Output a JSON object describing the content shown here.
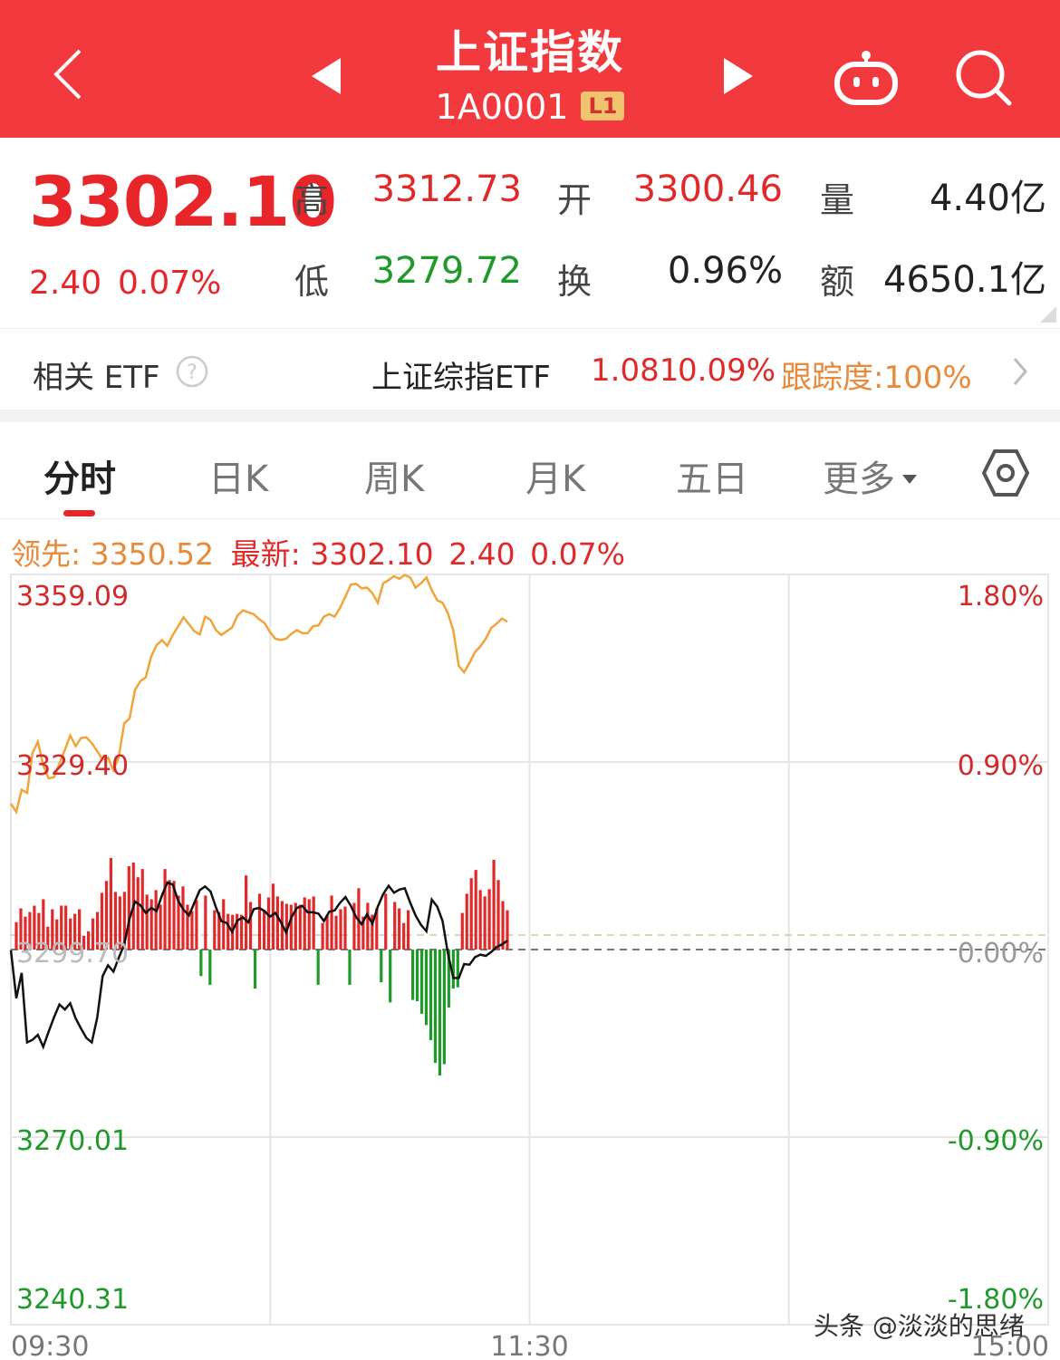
{
  "header": {
    "title": "上证指数",
    "code": "1A0001",
    "badge": "L1"
  },
  "quote": {
    "price": "3302.10",
    "change": "2.40",
    "change_pct": "0.07%",
    "high_label": "高",
    "high": "3312.73",
    "low_label": "低",
    "low": "3279.72",
    "open_label": "开",
    "open": "3300.46",
    "turnover_label": "换",
    "turnover": "0.96%",
    "volume_label": "量",
    "volume": "4.40亿",
    "amount_label": "额",
    "amount": "4650.1亿"
  },
  "etf": {
    "label": "相关 ETF",
    "name": "上证综指ETF",
    "price": "1.081",
    "pct": "0.09%",
    "tracking": "跟踪度:100%"
  },
  "tabs": [
    "分时",
    "日K",
    "周K",
    "月K",
    "五日",
    "更多"
  ],
  "legend": {
    "leader_label": "领先:",
    "leader_value": "3350.52",
    "latest_label": "最新:",
    "latest_value": "3302.10",
    "latest_change": "2.40",
    "latest_pct": "0.07%"
  },
  "watermark": "头条 @淡淡的思绪",
  "colors": {
    "up": "#e02a2a",
    "down": "#1f9a2a",
    "header": "#f23a3e",
    "leader": "#f0a43a",
    "accent_orange": "#e9893a"
  },
  "chart_data": {
    "type": "line",
    "prev_close": 3299.7,
    "ylim": [
      3240.31,
      3359.09
    ],
    "y_ticks_left": [
      "3359.09",
      "3329.40",
      "3299.70",
      "3270.01",
      "3240.31"
    ],
    "y_ticks_right": [
      "1.80%",
      "0.90%",
      "0.00%",
      "-0.90%",
      "-1.80%"
    ],
    "x_ticks": [
      "09:30",
      "11:30",
      "15:00"
    ],
    "series": [
      {
        "color": "#f0a43a",
        "values": [
          3322.8,
          3321.5,
          3325.0,
          3324.5,
          3330.8,
          3332.6,
          3328.9,
          3326.8,
          3327.0,
          3329.2,
          3331.3,
          3333.6,
          3331.9,
          3333.2,
          3333.3,
          3332.4,
          3331.1,
          3329.8,
          3330.1,
          3328.1,
          3330.2,
          3335.5,
          3336.3,
          3340.8,
          3342.2,
          3342.8,
          3346.1,
          3347.9,
          3348.7,
          3347.8,
          3349.5,
          3350.9,
          3352.3,
          3351.2,
          3350.1,
          3349.6,
          3352.4,
          3351.9,
          3350.3,
          3349.5,
          3350.1,
          3350.7,
          3352.6,
          3353.4,
          3353.1,
          3352.8,
          3352.0,
          3351.4,
          3350.0,
          3348.9,
          3348.7,
          3348.9,
          3349.7,
          3350.3,
          3349.8,
          3349.8,
          3350.9,
          3351.0,
          3352.4,
          3352.8,
          3352.4,
          3353.8,
          3355.6,
          3357.5,
          3357.6,
          3356.9,
          3357.0,
          3356.1,
          3354.6,
          3357.7,
          3358.2,
          3358.8,
          3358.4,
          3359.0,
          3358.6,
          3357.0,
          3357.7,
          3358.6,
          3356.6,
          3355.0,
          3354.6,
          3352.9,
          3350.2,
          3344.6,
          3343.6,
          3345.1,
          3346.8,
          3347.7,
          3348.9,
          3350.6,
          3351.3,
          3352.1,
          3351.6
        ]
      },
      {
        "color": "#111111",
        "values": [
          3299.6,
          3292.0,
          3296.0,
          3285.0,
          3285.4,
          3286.2,
          3284.3,
          3286.7,
          3289.0,
          3291.0,
          3290.2,
          3291.2,
          3288.8,
          3287.2,
          3285.7,
          3285.0,
          3288.9,
          3295.5,
          3297.2,
          3296.2,
          3298.4,
          3300.5,
          3304.6,
          3307.3,
          3306.7,
          3305.5,
          3306.3,
          3305.8,
          3308.3,
          3310.3,
          3310.0,
          3307.4,
          3306.0,
          3305.1,
          3307.1,
          3309.1,
          3309.7,
          3308.9,
          3306.4,
          3304.2,
          3303.9,
          3302.5,
          3304.3,
          3304.8,
          3304.0,
          3306.1,
          3306.3,
          3305.8,
          3304.9,
          3305.5,
          3304.1,
          3302.4,
          3304.8,
          3306.3,
          3306.6,
          3305.6,
          3305.6,
          3305.4,
          3304.2,
          3305.7,
          3305.9,
          3307.1,
          3308.0,
          3306.6,
          3304.8,
          3303.7,
          3305.3,
          3303.8,
          3306.5,
          3308.5,
          3309.8,
          3308.7,
          3309.2,
          3309.4,
          3307.1,
          3305.1,
          3303.6,
          3302.6,
          3307.6,
          3306.5,
          3304.2,
          3299.0,
          3295.2,
          3295.2,
          3297.4,
          3297.3,
          3298.5,
          3298.9,
          3298.7,
          3299.3,
          3300.1,
          3300.5,
          3301.1
        ]
      }
    ],
    "volume_bars": [
      0.3,
      0.45,
      0.36,
      0.41,
      0.48,
      0.4,
      0.55,
      0.25,
      0.44,
      0.33,
      0.48,
      0.48,
      0.34,
      0.39,
      0.44,
      0.15,
      0.2,
      0.34,
      0.41,
      0.62,
      0.75,
      1.0,
      0.63,
      0.58,
      0.63,
      0.91,
      0.95,
      0.79,
      0.88,
      0.6,
      0.55,
      0.65,
      0.49,
      0.88,
      0.76,
      0.75,
      0.59,
      0.69,
      0.49,
      0.42,
      0.54,
      -0.21,
      0.59,
      -0.28,
      0.43,
      0.41,
      0.55,
      0.39,
      0.38,
      0.39,
      0.38,
      0.81,
      0.52,
      -0.31,
      0.61,
      0.42,
      0.57,
      0.72,
      0.58,
      0.53,
      0.5,
      0.49,
      0.51,
      0.49,
      0.57,
      0.55,
      0.58,
      -0.28,
      0.29,
      0.38,
      0.59,
      0.37,
      0.44,
      0.47,
      -0.28,
      0.51,
      0.67,
      0.36,
      0.51,
      0.38,
      0.45,
      -0.26,
      0.61,
      -0.42,
      0.52,
      0.45,
      0.29,
      0.43,
      -0.4,
      -0.41,
      -0.51,
      -0.6,
      -0.72,
      -0.9,
      -1.0,
      -0.91,
      -0.46,
      -0.31,
      -0.3,
      0.4,
      0.61,
      0.78,
      0.87,
      0.65,
      0.58,
      0.66,
      0.98,
      0.76,
      0.53,
      0.43
    ]
  }
}
